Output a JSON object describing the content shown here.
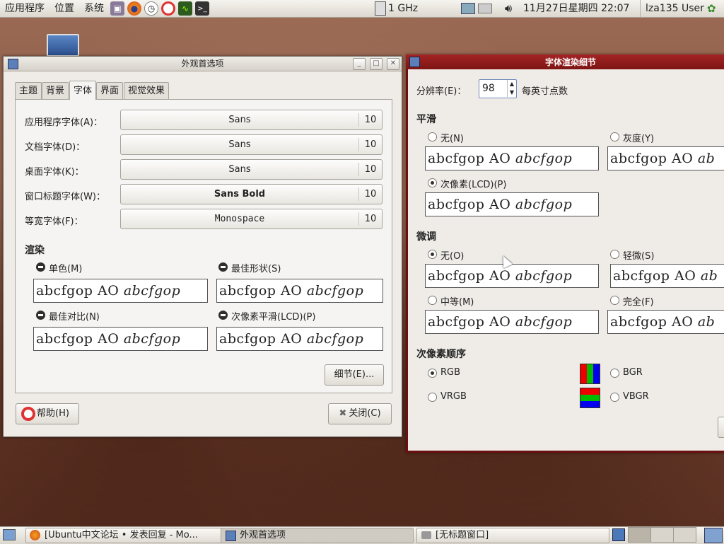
{
  "top_panel": {
    "menus": [
      "应用程序",
      "位置",
      "系统"
    ],
    "cpu_freq": "1 GHz",
    "datetime": "11月27日星期四 22:07",
    "user": "lza135 User"
  },
  "appearance_window": {
    "title": "外观首选项",
    "tabs": [
      "主题",
      "背景",
      "字体",
      "界面",
      "视觉效果"
    ],
    "active_tab": "字体",
    "font_rows": [
      {
        "label": "应用程序字体(A)：",
        "font": "Sans",
        "size": "10"
      },
      {
        "label": "文档字体(D)：",
        "font": "Sans",
        "size": "10"
      },
      {
        "label": "桌面字体(K)：",
        "font": "Sans",
        "size": "10"
      },
      {
        "label": "窗口标题字体(W)：",
        "font": "Sans Bold",
        "size": "10"
      },
      {
        "label": "等宽字体(F)：",
        "font": "Monospace",
        "size": "10"
      }
    ],
    "rendering_heading": "渲染",
    "rendering_options": [
      {
        "label": "单色(M)",
        "sample": "abcfgop AO",
        "sample_italic": "abcfgop"
      },
      {
        "label": "最佳形状(S)",
        "sample": "abcfgop AO",
        "sample_italic": "abcfgop"
      },
      {
        "label": "最佳对比(N)",
        "sample": "abcfgop AO",
        "sample_italic": "abcfgop"
      },
      {
        "label": "次像素平滑(LCD)(P)",
        "sample": "abcfgop AO",
        "sample_italic": "abcfgop"
      }
    ],
    "details_button": "细节(E)...",
    "help_button": "帮助(H)",
    "close_button": "关闭(C)"
  },
  "details_window": {
    "title": "字体渲染细节",
    "resolution_label": "分辨率(E)：",
    "resolution_value": "98",
    "resolution_unit": "每英寸点数",
    "smoothing_heading": "平滑",
    "smoothing": [
      {
        "label": "无(N)",
        "sample": "abcfgop AO",
        "sample_italic": "abcfgop"
      },
      {
        "label": "灰度(Y)",
        "sample": "abcfgop AO",
        "sample_italic": "ab"
      },
      {
        "label": "次像素(LCD)(P)",
        "sample": "abcfgop AO",
        "sample_italic": "abcfgop"
      }
    ],
    "hinting_heading": "微调",
    "hinting": [
      {
        "label": "无(O)",
        "sample": "abcfgop AO",
        "sample_italic": "abcfgop"
      },
      {
        "label": "轻微(S)",
        "sample": "abcfgop AO",
        "sample_italic": "ab"
      },
      {
        "label": "中等(M)",
        "sample": "abcfgop AO",
        "sample_italic": "abcfgop"
      },
      {
        "label": "完全(F)",
        "sample": "abcfgop AO",
        "sample_italic": "ab"
      }
    ],
    "subpixel_heading": "次像素顺序",
    "subpixel": [
      {
        "label": "RGB"
      },
      {
        "label": "BGR"
      },
      {
        "label": "VRGB"
      },
      {
        "label": "VBGR"
      }
    ]
  },
  "taskbar": {
    "items": [
      "[Ubuntu中文论坛 • 发表回复 - Mo...",
      "外观首选项",
      "[无标题窗口]"
    ]
  },
  "colors": {
    "details_titlebar": "#8b1a1a",
    "appearance_titlebar": "#dcd8d1"
  }
}
